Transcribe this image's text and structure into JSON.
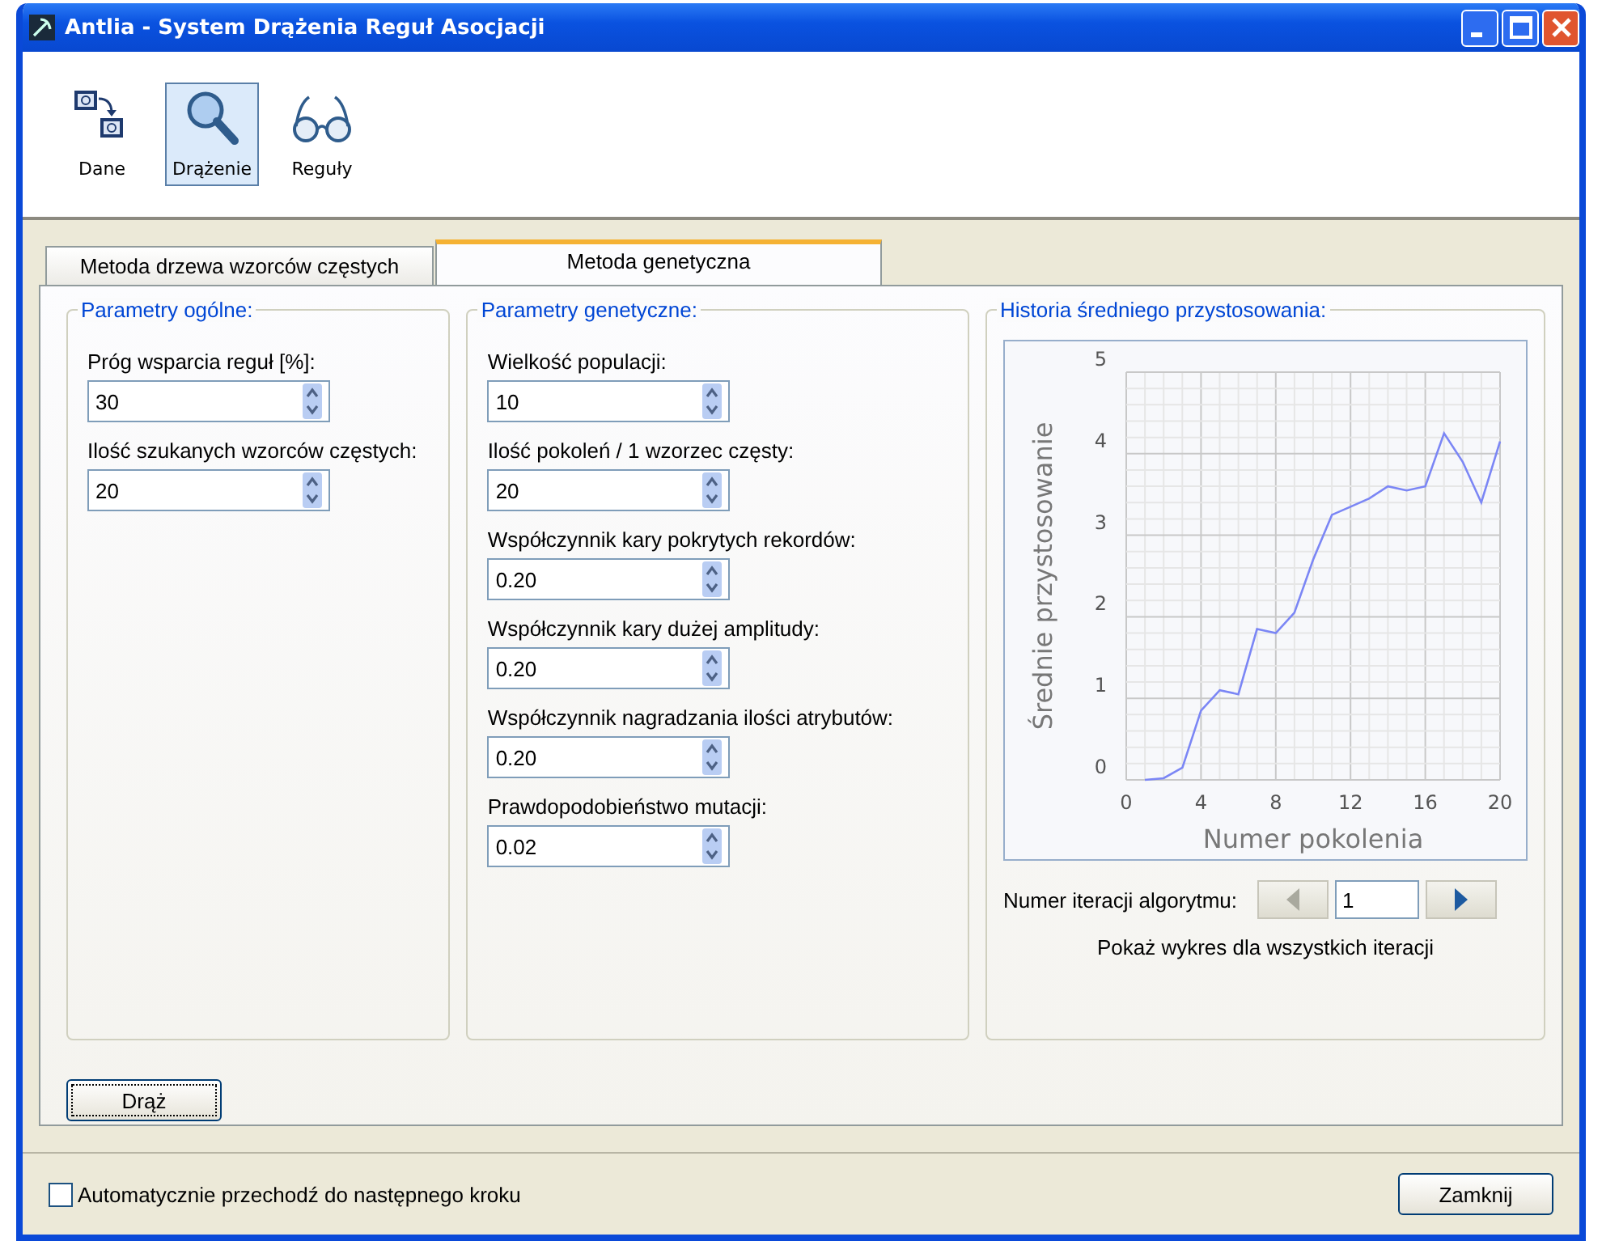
{
  "window": {
    "title": "Antlia - System Drążenia Reguł Asocjacji"
  },
  "toolbar": [
    {
      "label": "Dane",
      "selected": false
    },
    {
      "label": "Drążenie",
      "selected": true
    },
    {
      "label": "Reguły",
      "selected": false
    }
  ],
  "tabs": [
    {
      "label": "Metoda drzewa wzorców częstych",
      "selected": false
    },
    {
      "label": "Metoda genetyczna",
      "selected": true
    }
  ],
  "general_params": {
    "title": "Parametry ogólne:",
    "fields": [
      {
        "label": "Próg wsparcia reguł [%]:",
        "value": "30"
      },
      {
        "label": "Ilość szukanych wzorców częstych:",
        "value": "20"
      }
    ]
  },
  "genetic_params": {
    "title": "Parametry genetyczne:",
    "fields": [
      {
        "label": "Wielkość populacji:",
        "value": "10"
      },
      {
        "label": "Ilość pokoleń / 1 wzorzec częsty:",
        "value": "20"
      },
      {
        "label": "Współczynnik kary pokrytych rekordów:",
        "value": "0.20"
      },
      {
        "label": "Współczynnik kary dużej amplitudy:",
        "value": "0.20"
      },
      {
        "label": "Współczynnik nagradzania ilości atrybutów:",
        "value": "0.20"
      },
      {
        "label": "Prawdopodobieństwo mutacji:",
        "value": "0.02"
      }
    ]
  },
  "history": {
    "title": "Historia średniego przystosowania:",
    "chart_data": {
      "type": "line",
      "xlabel": "Numer pokolenia",
      "ylabel": "Średnie przystosowanie",
      "x": [
        1,
        2,
        3,
        4,
        5,
        6,
        7,
        8,
        9,
        10,
        11,
        12,
        13,
        14,
        15,
        16,
        17,
        18,
        19,
        20
      ],
      "grid": true,
      "series": [
        {
          "color": "#7b86f5",
          "values": [
            0,
            0.02,
            0.15,
            0.85,
            1.1,
            1.05,
            1.85,
            1.8,
            2.05,
            2.7,
            3.25,
            3.35,
            3.45,
            3.6,
            3.55,
            3.6,
            4.25,
            3.9,
            3.4,
            4.15
          ]
        }
      ],
      "xlim": [
        0,
        20
      ],
      "ylim": [
        0,
        5
      ],
      "xticks": [
        0,
        4,
        8,
        12,
        16,
        20
      ],
      "yticks": [
        0,
        1,
        2,
        3,
        4,
        5
      ]
    },
    "iteration_label": "Numer iteracji algorytmu:",
    "iteration": "1",
    "nav": [
      {
        "kind": "prev",
        "disabled": true
      },
      {
        "kind": "next",
        "disabled": false
      }
    ],
    "show_all_link": "Pokaż wykres dla wszystkich iteracji"
  },
  "run_button": "Drąż",
  "auto_next": {
    "label": "Automatycznie przechodź do następnego kroku",
    "checked": false
  },
  "close_button": "Zamknij"
}
